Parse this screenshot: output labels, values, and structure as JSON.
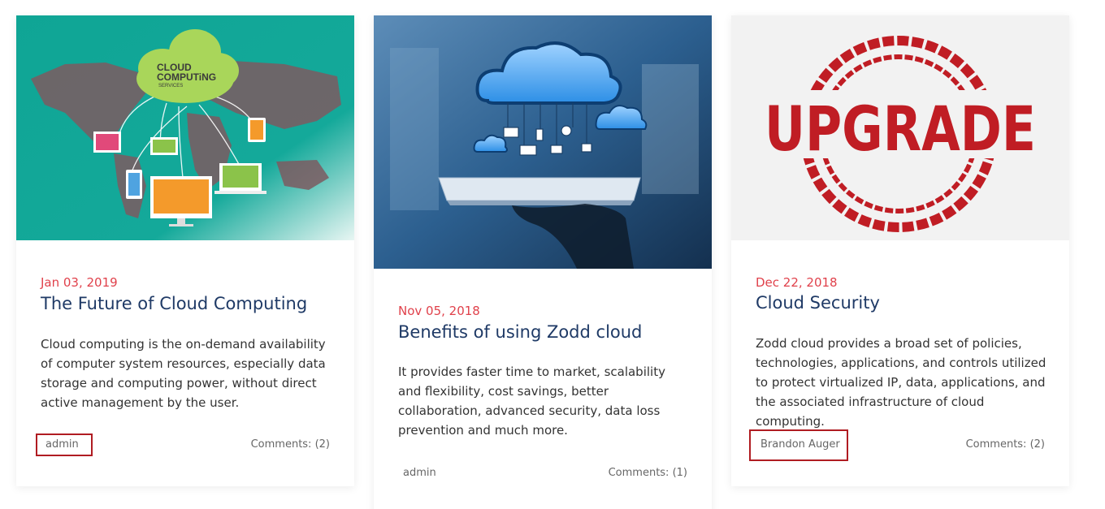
{
  "posts": [
    {
      "date": "Jan 03, 2019",
      "title": "The Future of Cloud Computing",
      "excerpt": "Cloud computing is the on-demand availability of computer system resources, especially data storage and computing power, without direct active management by the user.",
      "author": "admin",
      "comments": "Comments: (2)",
      "image": {
        "icon": "cloud-computing-world-map-image",
        "bg_color": "#1aa89a",
        "cloud_text_1": "CLOUD",
        "cloud_text_2": "COMPUTiNG",
        "cloud_text_3": "SERVICES"
      }
    },
    {
      "date": "Nov 05, 2018",
      "title": "Benefits of using Zodd cloud",
      "excerpt": "It provides faster time to market, scalability and flexibility, cost savings, better collaboration, advanced security, data loss prevention and much more.",
      "author": "admin",
      "comments": "Comments: (1)",
      "image": {
        "icon": "cloud-on-tablet-image",
        "bg_color": "#2c5f8f"
      }
    },
    {
      "date": "Dec 22, 2018",
      "title": "Cloud Security",
      "excerpt": "Zodd cloud provides a broad set of policies, technologies, applications, and controls utilized to protect virtualized IP, data, applications, and the associated infrastructure of cloud computing.",
      "author": "Brandon Auger",
      "comments": "Comments: (2)",
      "image": {
        "icon": "upgrade-stamp-image",
        "bg_color": "#f2f2f2",
        "stamp_text": "UPGRADE",
        "stamp_color": "#c01d24"
      }
    }
  ],
  "colors": {
    "date": "#e0414b",
    "title": "#1f3a66",
    "highlight_border": "#b01c22"
  }
}
